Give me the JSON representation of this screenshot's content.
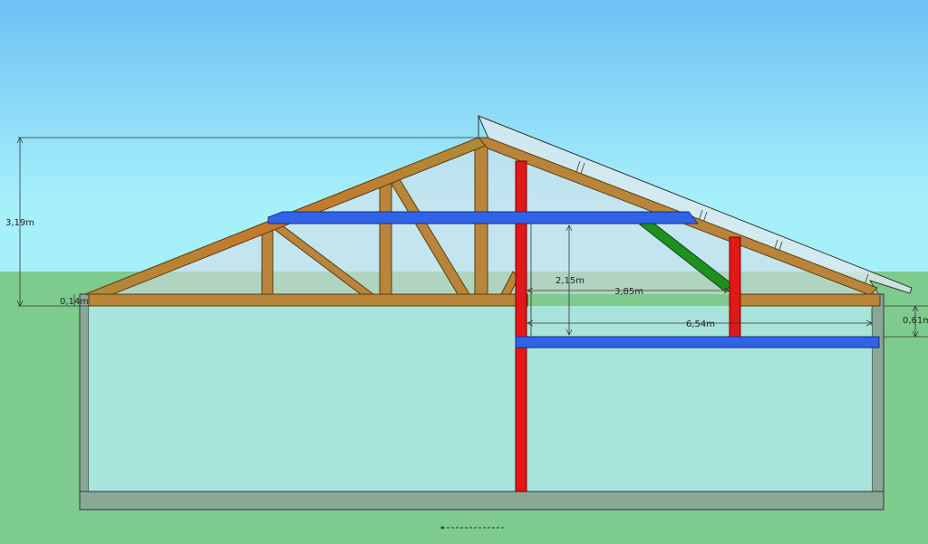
{
  "dimensions": {
    "total_height": "3,19m",
    "small_left": "0,14m",
    "interior_height": "2,15m",
    "span_short": "3,85m",
    "span_long": "6,54m",
    "right_drop": "0,61m"
  },
  "colors": {
    "sky_top": "#6ec0f5",
    "sky_bottom": "#a6f0fa",
    "ground": "#7ecb8e",
    "wall_fill": "#a8e3dc",
    "wall_frame": "#8aa898",
    "timber": "#b9832f",
    "timber_ridge": "#c7772b",
    "blue_beam": "#2f63e8",
    "red_post": "#e01818",
    "green_brace": "#1f8f1f",
    "roof_glass": "#dfe8ee"
  }
}
